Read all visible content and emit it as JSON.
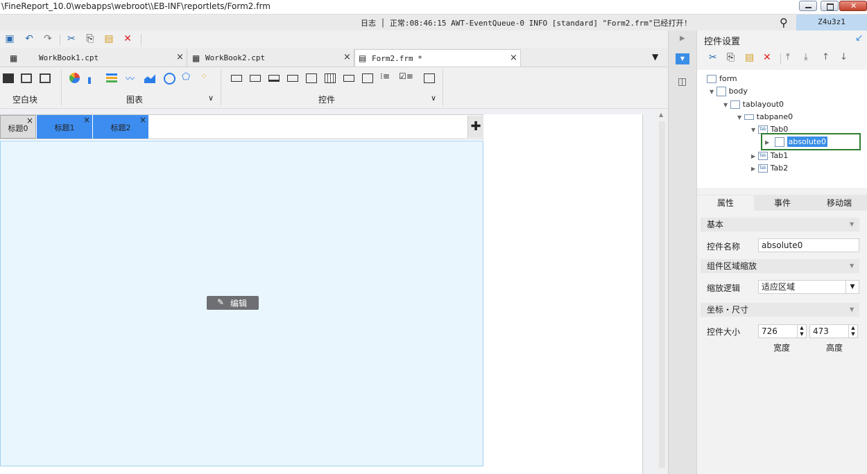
{
  "window": {
    "title": "\\FineReport_10.0\\webapps\\webroot\\\\EB-INF\\reportlets/Form2.frm"
  },
  "statusbar": {
    "text": "日志 │ 正常:08:46:15 AWT-EventQueue-0 INFO [standard] \"Form2.frm\"已经打开!",
    "user": "Z4u3z1"
  },
  "doc_tabs": [
    {
      "label": "WorkBook1.cpt",
      "close": "×"
    },
    {
      "label": "WorkBook2.cpt",
      "close": "×"
    },
    {
      "label": "Form2.frm *",
      "close": "×"
    }
  ],
  "ribbon": {
    "group1": "空白块",
    "group2": "图表",
    "group3": "控件",
    "chev": "∨"
  },
  "canvas_tabs": [
    {
      "label": "标题0",
      "close": "×"
    },
    {
      "label": "标题1",
      "close": "×"
    },
    {
      "label": "标题2",
      "close": "×"
    }
  ],
  "edit_label": "编辑",
  "panel": {
    "title": "控件设置",
    "tree": {
      "form": "form",
      "body": "body",
      "tablayout": "tablayout0",
      "tabpane": "tabpane0",
      "tab0": "Tab0",
      "absolute": "absolute0",
      "tab1": "Tab1",
      "tab2": "Tab2",
      "tab_icon": "Tab"
    },
    "tabs": [
      "属性",
      "事件",
      "移动端"
    ],
    "basic": "基本",
    "name_label": "控件名称",
    "name_value": "absolute0",
    "scale_section": "组件区域缩放",
    "scale_label": "缩放逻辑",
    "scale_value": "适应区域",
    "coord_section": "坐标・尺寸",
    "size_label": "控件大小",
    "width_value": "726",
    "height_value": "473",
    "width_label": "宽度",
    "height_label": "高度"
  },
  "colors": {
    "accent": "#3a8ee6",
    "selected_tab": "#3d8df0",
    "pane_bg": "#e9f6fd",
    "highlight_border": "#2e7d32"
  }
}
